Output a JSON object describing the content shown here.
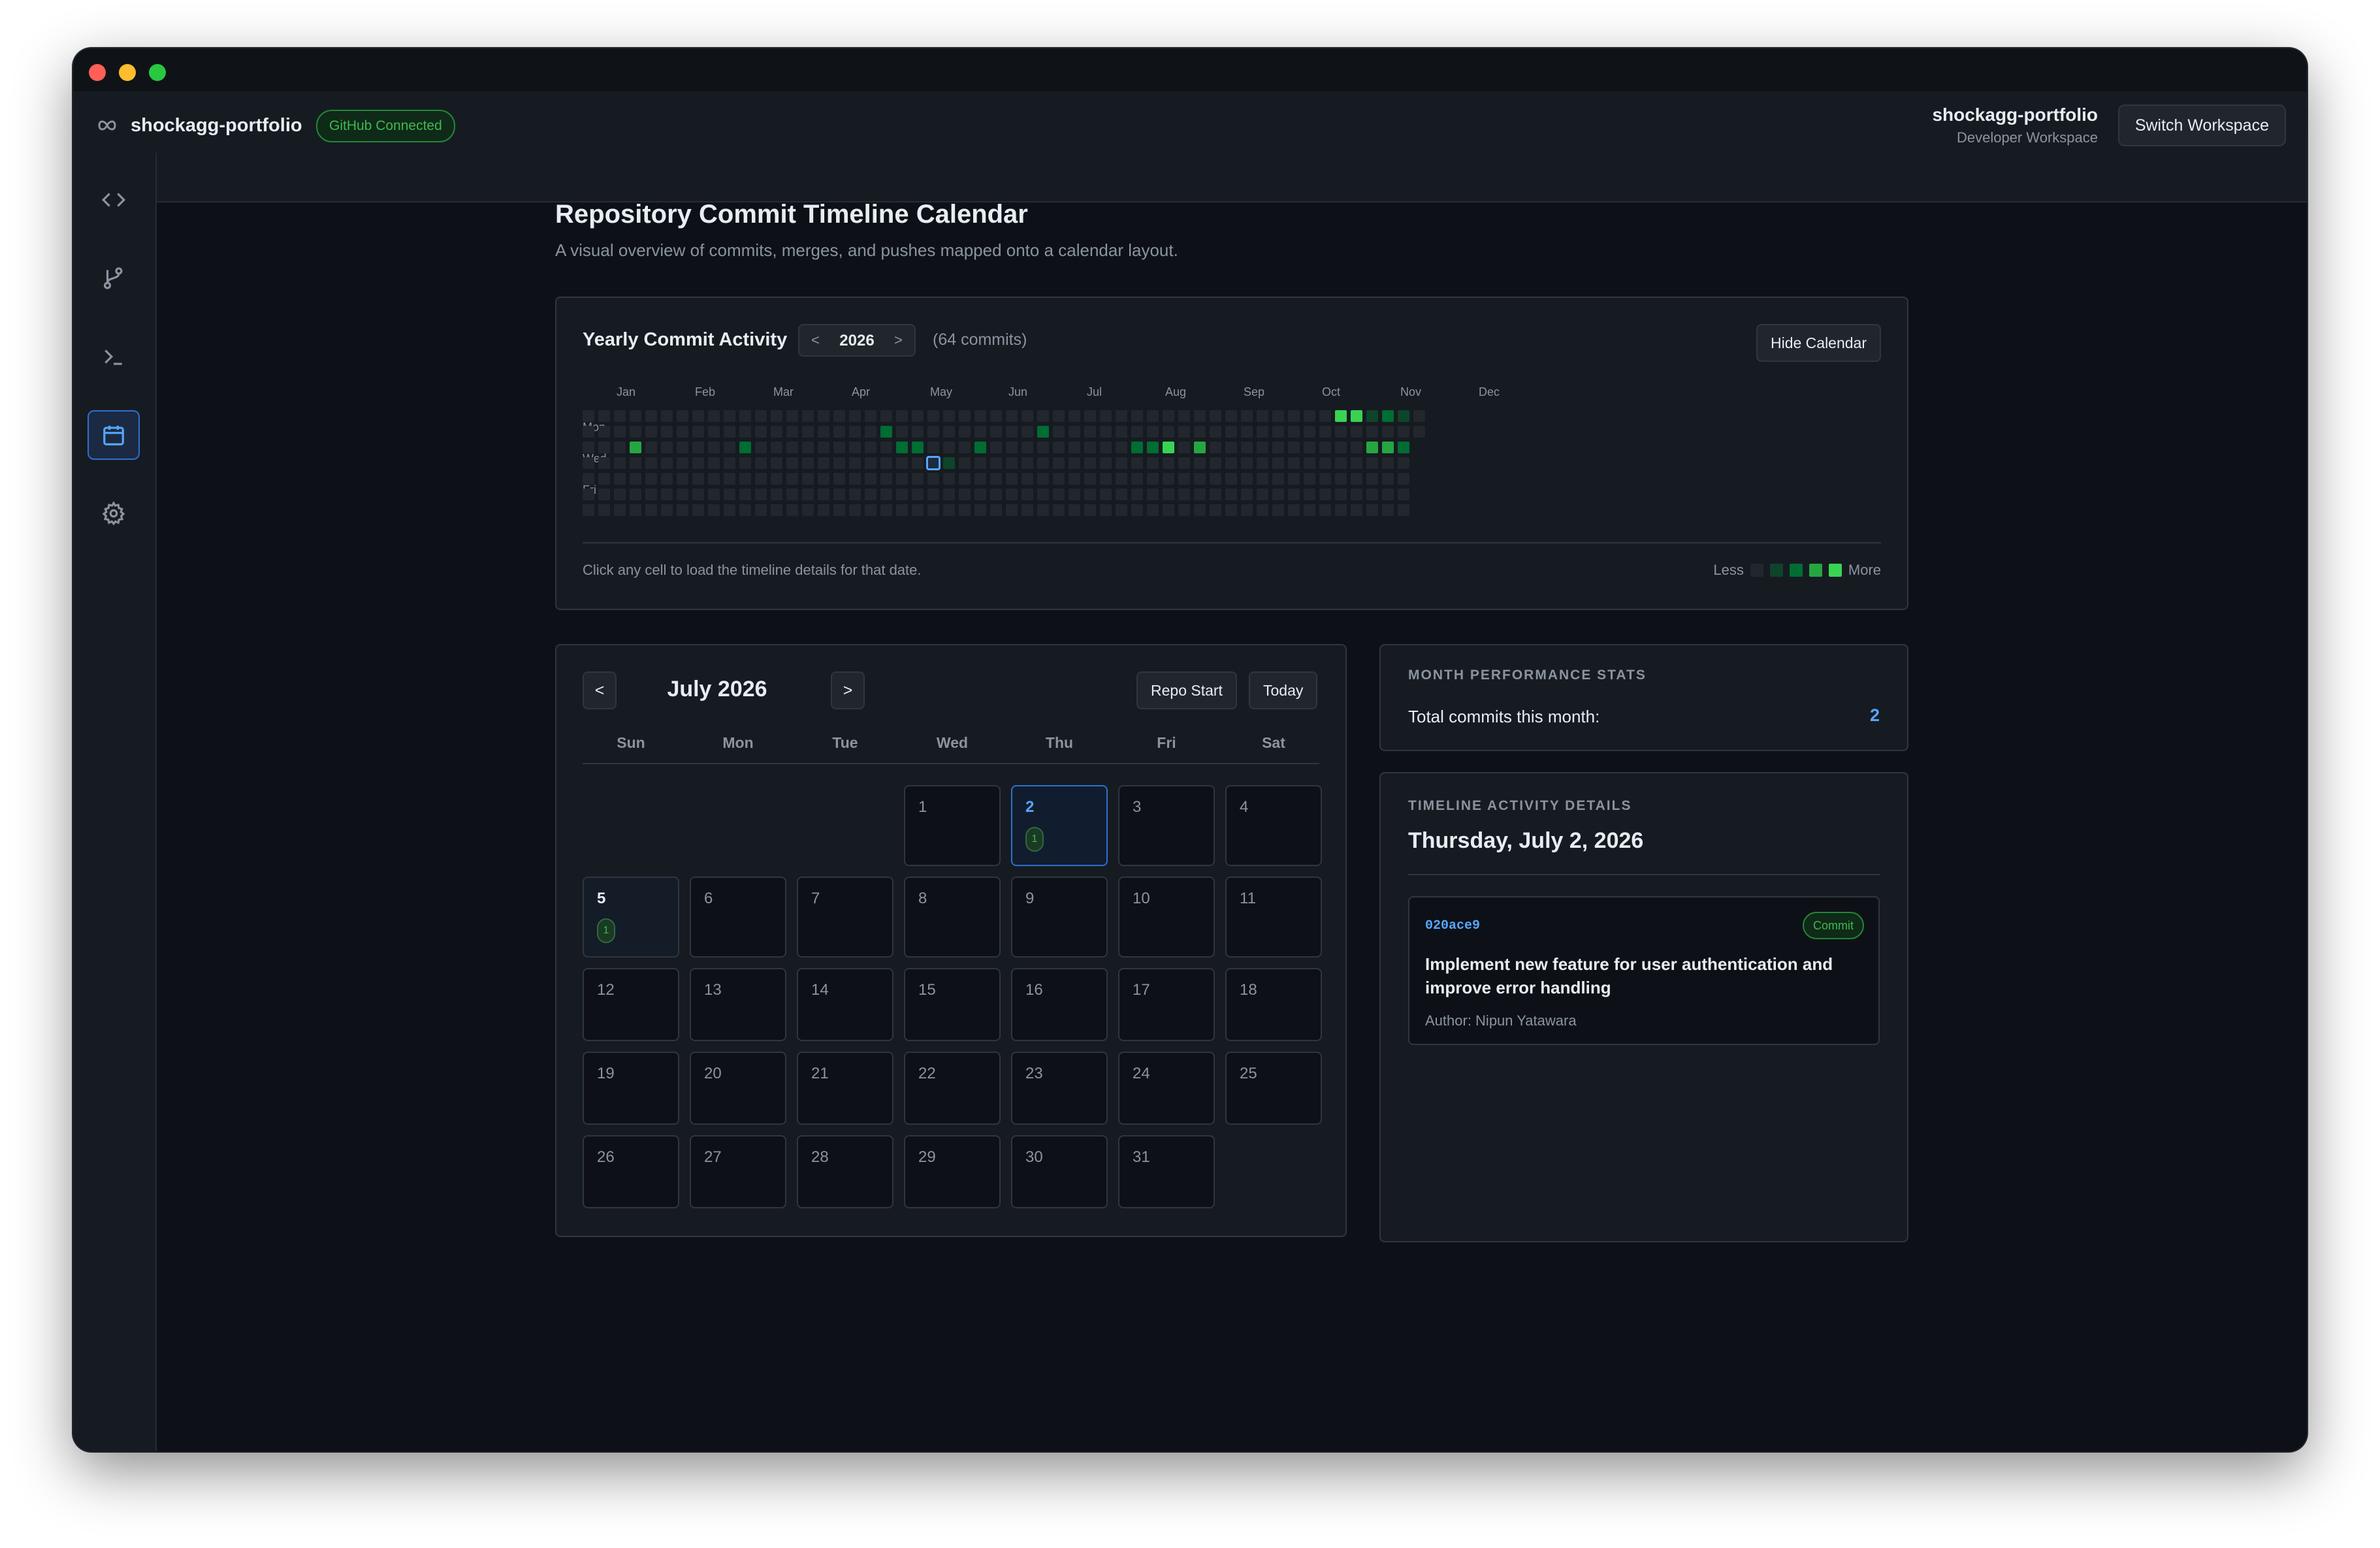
{
  "app": {
    "repo_name": "shockagg-portfolio",
    "connection_badge": "GitHub Connected",
    "workspace_name": "shockagg-portfolio",
    "workspace_type": "Developer Workspace",
    "switch_workspace_label": "Switch Workspace"
  },
  "sidebar": {
    "items": [
      {
        "name": "code-icon",
        "active": false
      },
      {
        "name": "git-branch-icon",
        "active": false
      },
      {
        "name": "terminal-icon",
        "active": false
      },
      {
        "name": "calendar-icon",
        "active": true
      },
      {
        "name": "gear-icon",
        "active": false
      }
    ]
  },
  "page": {
    "title": "Repository Commit Timeline Calendar",
    "subtitle": "A visual overview of commits, merges, and pushes mapped onto a calendar layout."
  },
  "yearly": {
    "title": "Yearly Commit Activity",
    "prev": "<",
    "next": ">",
    "year": "2026",
    "commit_count": "(64 commits)",
    "hide_label": "Hide Calendar",
    "months": [
      "Jan",
      "Feb",
      "Mar",
      "Apr",
      "May",
      "Jun",
      "Jul",
      "Aug",
      "Sep",
      "Oct",
      "Nov",
      "Dec"
    ],
    "day_labels": [
      "Mon",
      "Wed",
      "Fri"
    ],
    "hint": "Click any cell to load the timeline details for that date.",
    "legend_less": "Less",
    "legend_more": "More",
    "levels": [
      "#22272e",
      "#0e4429",
      "#006d32",
      "#26a641",
      "#39d353"
    ],
    "active_cells": [
      {
        "week": 3,
        "day": 2,
        "level": 3
      },
      {
        "week": 10,
        "day": 2,
        "level": 2
      },
      {
        "week": 19,
        "day": 1,
        "level": 2
      },
      {
        "week": 20,
        "day": 2,
        "level": 2
      },
      {
        "week": 21,
        "day": 2,
        "level": 2
      },
      {
        "week": 23,
        "day": 3,
        "level": 1
      },
      {
        "week": 25,
        "day": 2,
        "level": 2
      },
      {
        "week": 29,
        "day": 1,
        "level": 2
      },
      {
        "week": 35,
        "day": 2,
        "level": 2
      },
      {
        "week": 36,
        "day": 2,
        "level": 2
      },
      {
        "week": 37,
        "day": 2,
        "level": 4
      },
      {
        "week": 39,
        "day": 2,
        "level": 3
      },
      {
        "week": 48,
        "day": 0,
        "level": 4
      },
      {
        "week": 49,
        "day": 0,
        "level": 4
      },
      {
        "week": 50,
        "day": 0,
        "level": 1
      },
      {
        "week": 50,
        "day": 2,
        "level": 3
      },
      {
        "week": 51,
        "day": 0,
        "level": 2
      },
      {
        "week": 51,
        "day": 2,
        "level": 3
      },
      {
        "week": 52,
        "day": 0,
        "level": 1
      },
      {
        "week": 52,
        "day": 2,
        "level": 2
      }
    ],
    "selected_cell": {
      "week": 22,
      "day": 3
    }
  },
  "calendar": {
    "prev": "<",
    "next": ">",
    "month_label": "July 2026",
    "repo_start_label": "Repo Start",
    "today_label": "Today",
    "weekdays": [
      "Sun",
      "Mon",
      "Tue",
      "Wed",
      "Thu",
      "Fri",
      "Sat"
    ],
    "first_weekday": 3,
    "days_in_month": 31,
    "today": 2,
    "commit_days": [
      {
        "day": 2,
        "count": "1"
      },
      {
        "day": 5,
        "count": "1"
      }
    ]
  },
  "stats": {
    "section_label": "MONTH PERFORMANCE STATS",
    "total_label": "Total commits this month:",
    "total_value": "2"
  },
  "details": {
    "section_label": "TIMELINE ACTIVITY DETAILS",
    "date": "Thursday, July 2, 2026",
    "commit": {
      "sha": "020ace9",
      "type": "Commit",
      "message": "Implement new feature for user authentication and improve error handling",
      "author": "Author: Nipun Yatawara"
    }
  }
}
